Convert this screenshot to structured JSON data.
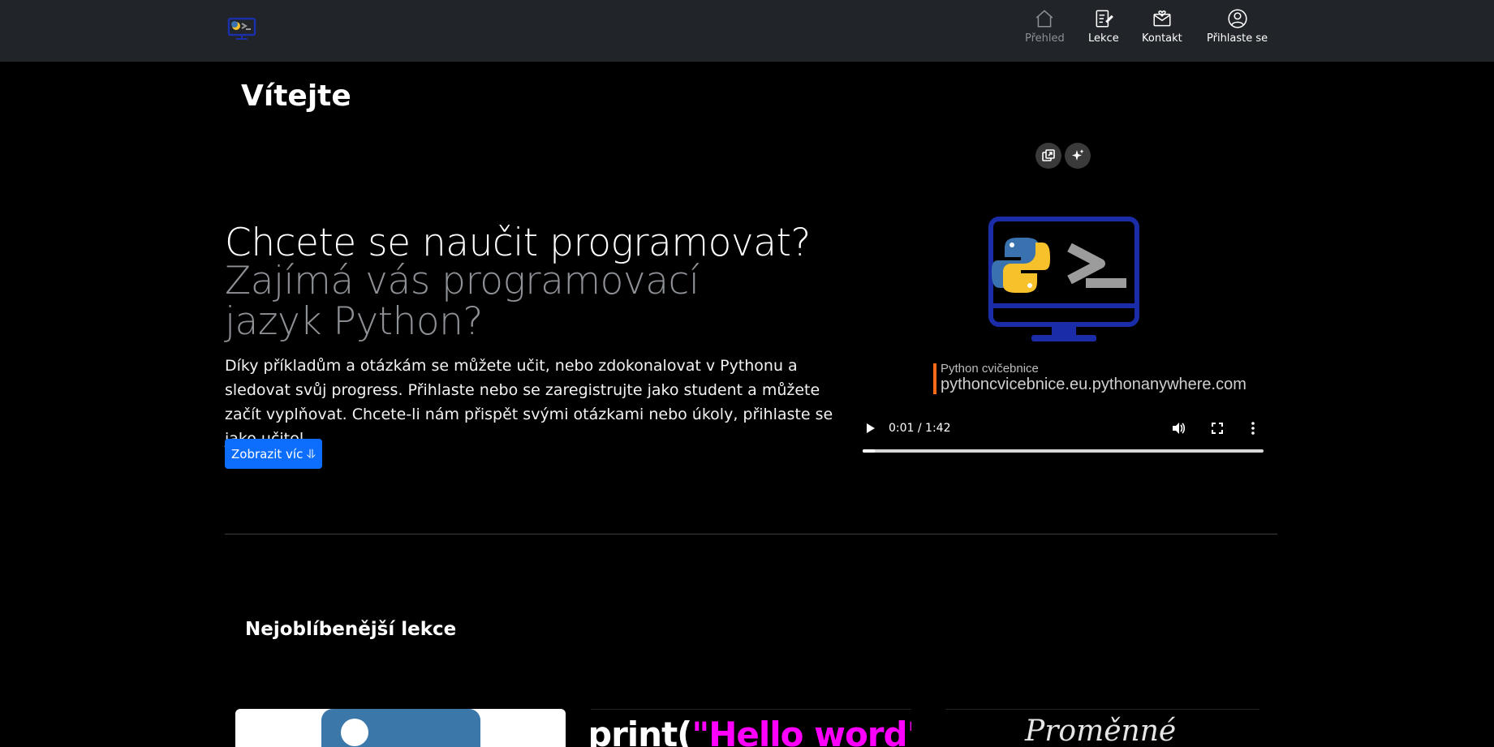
{
  "nav": {
    "items": [
      {
        "label": "Přehled",
        "icon": "house-icon",
        "active": true
      },
      {
        "label": "Lekce",
        "icon": "journal-edit-icon"
      },
      {
        "label": "Kontakt",
        "icon": "envelope-heart-icon"
      },
      {
        "label": "Přihlaste se",
        "icon": "person-circle-icon"
      }
    ]
  },
  "page": {
    "title": "Vítejte"
  },
  "hero": {
    "headline": "Chcete se naučit programovat?",
    "subheadline": "Zajímá vás programovací jazyk Python?",
    "body": "Díky příkladům a otázkám se můžete učit, nebo zdokonalovat v Pythonu a sledovat svůj progress. Přihlaste nebo se zaregistrujte jako student a můžete začít vyplňovat. Chcete-li nám přispět svými otázkami nebo úkoly, přihlaste se jako učitel.",
    "button_label": "Zobrazit víc ⥥",
    "accent_color": "#0d6efd"
  },
  "video": {
    "caption_title": "Python cvičebnice",
    "caption_url": "pythoncvicebnice.eu.pythonanywhere.com",
    "time": "0:01 / 1:42",
    "progress_fraction": 0.03
  },
  "popular": {
    "title": "Nejoblíbenější lekce",
    "cards": [
      {
        "type": "image"
      },
      {
        "code_prefix": "print(",
        "code_string": "\"Hello word\"",
        "code_suffix": ")"
      },
      {
        "title": "Proměnné"
      }
    ]
  }
}
